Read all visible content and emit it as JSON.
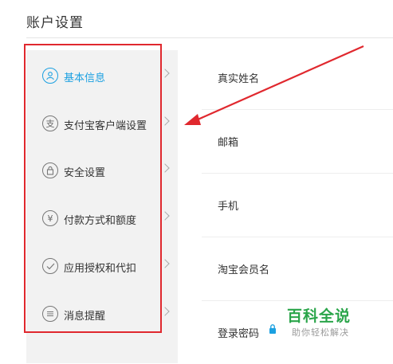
{
  "page": {
    "title": "账户设置"
  },
  "sidebar": {
    "items": [
      {
        "label": "基本信息",
        "icon": "user-icon",
        "active": true
      },
      {
        "label": "支付宝客户端设置",
        "icon": "alipay-icon",
        "active": false
      },
      {
        "label": "安全设置",
        "icon": "lock-icon",
        "active": false
      },
      {
        "label": "付款方式和额度",
        "icon": "yuan-icon",
        "active": false
      },
      {
        "label": "应用授权和代扣",
        "icon": "check-icon",
        "active": false
      },
      {
        "label": "消息提醒",
        "icon": "message-icon",
        "active": false
      }
    ]
  },
  "main": {
    "fields": [
      {
        "label": "真实姓名"
      },
      {
        "label": "邮箱"
      },
      {
        "label": "手机"
      },
      {
        "label": "淘宝会员名"
      },
      {
        "label": "登录密码"
      }
    ]
  },
  "watermark": {
    "brand": "百科全说",
    "tagline": "助你轻松解决"
  },
  "colors": {
    "accent": "#1ba0e1",
    "annotation_red": "#e0282e",
    "watermark_green": "#2aa54a"
  }
}
